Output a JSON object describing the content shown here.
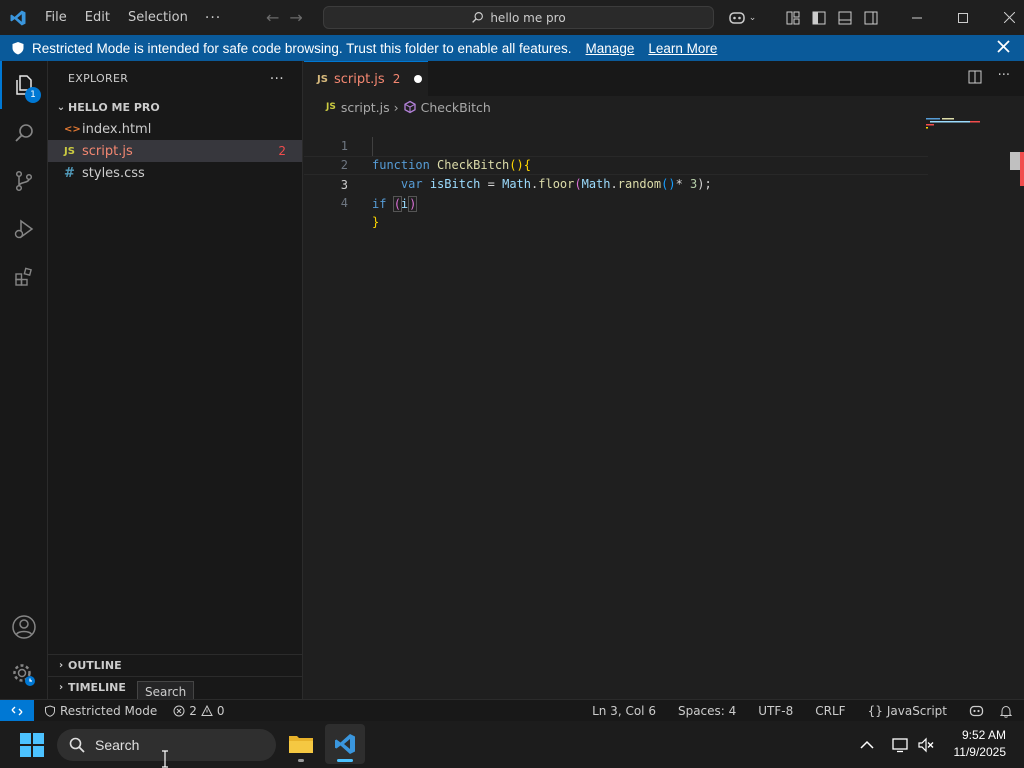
{
  "titlebar": {
    "menu": [
      "File",
      "Edit",
      "Selection"
    ],
    "more": "···",
    "search": "hello me pro"
  },
  "banner": {
    "text": "Restricted Mode is intended for safe code browsing. Trust this folder to enable all features.",
    "manage": "Manage",
    "learn_more": "Learn More",
    "bg_color": "#0a5a9a"
  },
  "activity": {
    "explorer_badge": "1"
  },
  "sidebar": {
    "title": "EXPLORER",
    "more": "···",
    "folder": "HELLO ME PRO",
    "files": [
      {
        "icon": "<>",
        "name": "index.html",
        "badge": ""
      },
      {
        "icon": "JS",
        "name": "script.js",
        "badge": "2"
      },
      {
        "icon": "#",
        "name": "styles.css",
        "badge": ""
      }
    ],
    "outline": "OUTLINE",
    "timeline": "TIMELINE"
  },
  "tooltip": "Search",
  "editor": {
    "tab": {
      "lang": "JS",
      "name": "script.js",
      "problems": "2"
    },
    "breadcrumb": {
      "file": "script.js",
      "symbol": "CheckBitch"
    },
    "line_numbers": [
      "1",
      "2",
      "3",
      "4"
    ],
    "code": {
      "l1_kw": "function",
      "l1_fn": "CheckBitch",
      "l1_paren": "()",
      "l1_brace": "{",
      "l2_kw": "var",
      "l2_var": "isBitch",
      "l2_eq": "=",
      "l2_obj": "Math",
      "l2_method": "floor",
      "l2_open": "(",
      "l2_obj2": "Math",
      "l2_method2": "random",
      "l2_parens": "()",
      "l2_rest": "* ",
      "l2_num": "3",
      "l2_close": ");",
      "l3_kw": "if",
      "l3_open": "(",
      "l3_var": "i",
      "l3_close": ")",
      "l4_brace": "}"
    }
  },
  "statusbar": {
    "restricted": "Restricted Mode",
    "errors": "2",
    "warnings": "0",
    "position": "Ln 3, Col 6",
    "spaces": "Spaces: 4",
    "encoding": "UTF-8",
    "eol": "CRLF",
    "language": "JavaScript"
  },
  "taskbar": {
    "search": "Search",
    "time": "9:52 AM",
    "date": "11/9/2025"
  }
}
